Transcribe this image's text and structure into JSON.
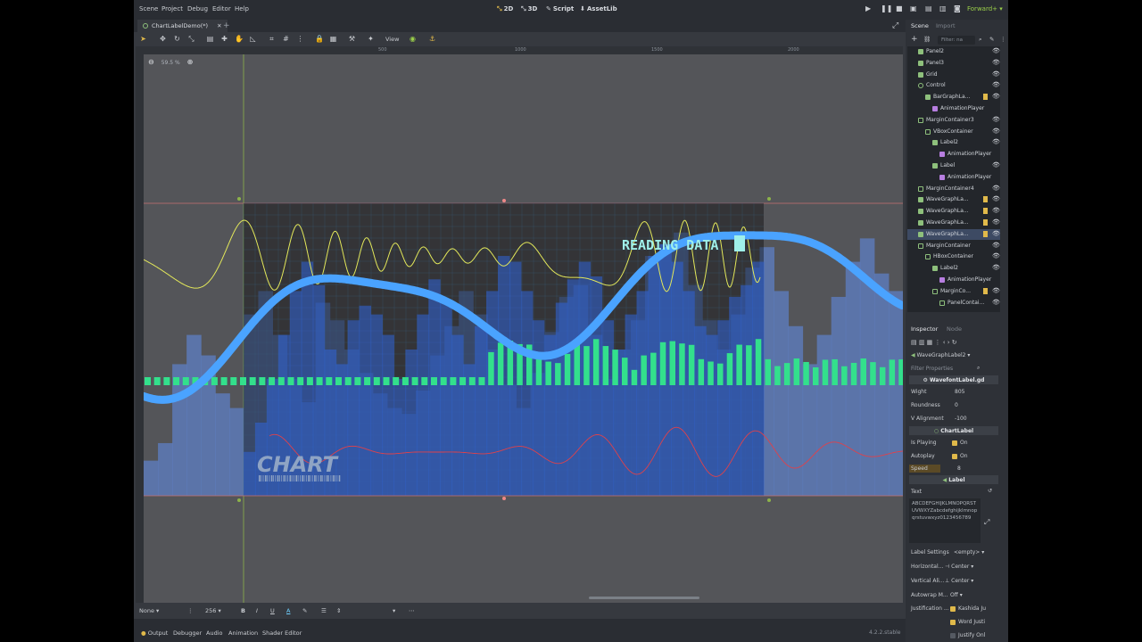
{
  "menubar": {
    "items": [
      "Scene",
      "Project",
      "Debug",
      "Editor",
      "Help"
    ],
    "workspaces": [
      "2D",
      "3D",
      "Script",
      "AssetLib"
    ],
    "renderer": "Forward+"
  },
  "tabs": {
    "scene_tab": "ChartLabelDemo(*)"
  },
  "toolbar": {
    "view_label": "View"
  },
  "viewport": {
    "zoom_label": "59.5 %",
    "ruler_numbers": [
      "500",
      "1000",
      "1500",
      "2000"
    ],
    "chart_title": "READING DATA",
    "chart_logo": "CHART"
  },
  "textbar": {
    "font_mode": "None",
    "font_size": "256"
  },
  "bottom_tabs": [
    "Output",
    "Debugger",
    "Audio",
    "Animation",
    "Shader Editor"
  ],
  "version": "4.2.2.stable",
  "scene_dock": {
    "tabs": [
      "Scene",
      "Import"
    ],
    "filter_placeholder": "Filter: na",
    "nodes": [
      {
        "name": "Panel2",
        "icon": "green"
      },
      {
        "name": "Panel3",
        "icon": "green"
      },
      {
        "name": "Grid",
        "icon": "green"
      },
      {
        "name": "Control",
        "icon": "ring"
      },
      {
        "name": "BarGraphLa...",
        "icon": "green"
      },
      {
        "name": "AnimationPlayer",
        "icon": "purple"
      },
      {
        "name": "MarginContainer3",
        "icon": "box"
      },
      {
        "name": "VBoxContainer",
        "icon": "box"
      },
      {
        "name": "Label2",
        "icon": "green"
      },
      {
        "name": "AnimationPlayer",
        "icon": "purple"
      },
      {
        "name": "Label",
        "icon": "green"
      },
      {
        "name": "AnimationPlayer",
        "icon": "purple"
      },
      {
        "name": "MarginContainer4",
        "icon": "box"
      },
      {
        "name": "WaveGraphLa...",
        "icon": "green"
      },
      {
        "name": "WaveGraphLa...",
        "icon": "green"
      },
      {
        "name": "WaveGraphLa...",
        "icon": "green"
      },
      {
        "name": "WaveGraphLa...",
        "icon": "green"
      },
      {
        "name": "MarginContainer",
        "icon": "box"
      },
      {
        "name": "HBoxContainer",
        "icon": "box"
      },
      {
        "name": "Label2",
        "icon": "green"
      },
      {
        "name": "AnimationPlayer",
        "icon": "purple"
      },
      {
        "name": "MarginCo...",
        "icon": "box"
      },
      {
        "name": "PanelContai...",
        "icon": "box"
      }
    ]
  },
  "inspector": {
    "tabs": [
      "Inspector",
      "Node"
    ],
    "selected_node": "WaveGraphLabel2",
    "filter_placeholder": "Filter Properties",
    "resource": "WavefontLabel.gd",
    "width_label": "Wight",
    "width_value": "805",
    "roundness_label": "Roundness",
    "roundness_value": "0",
    "valign_label": "V Alignment",
    "valign_value": "-100",
    "section_chartlabel": "ChartLabel",
    "is_playing_label": "Is Playing",
    "is_playing_value": "On",
    "autoplay_label": "Autoplay",
    "autoplay_value": "On",
    "speed_label": "Speed",
    "speed_value": "8",
    "section_label": "Label",
    "text_label": "Text",
    "text_value": "ABCDEFGHIJKLMNOPQRSTUVWXYZabcdefghijklmnopqrstuvwxyz0123456789",
    "label_settings_label": "Label Settings",
    "label_settings_value": "<empty>",
    "horizontal_label": "Horizontal...",
    "horizontal_value": "Center",
    "vertical_label": "Vertical Ali...",
    "vertical_value": "Center",
    "autowrap_label": "Autowrap M...",
    "autowrap_value": "Off",
    "justification_label": "Justification ...",
    "just_opt1": "Kashida Ju",
    "just_opt2": "Word Justi",
    "just_opt3": "Justify Onl"
  }
}
